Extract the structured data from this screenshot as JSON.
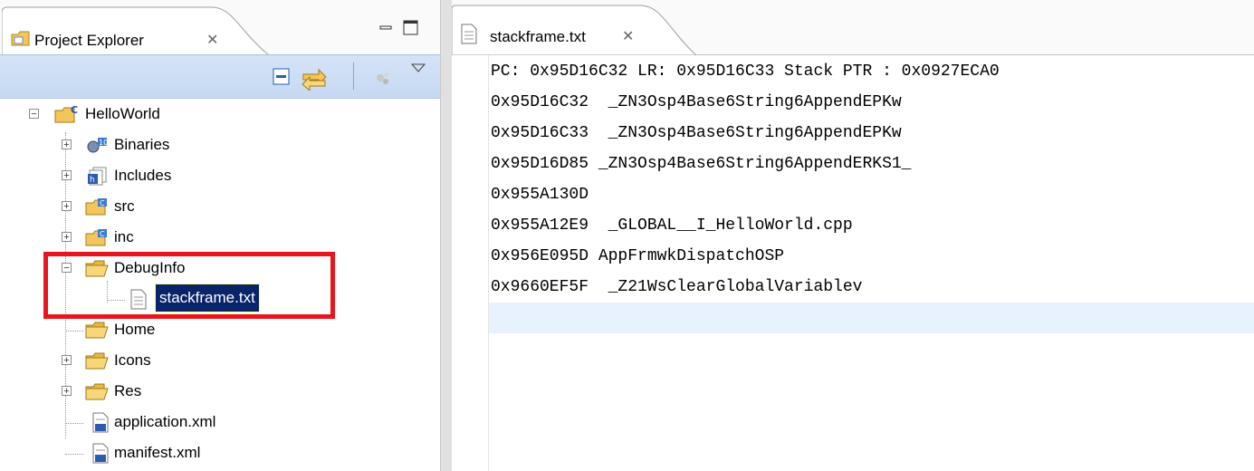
{
  "explorer": {
    "title": "Project Explorer",
    "close_glyph": "✕",
    "toolbar": {
      "collapse_icon": "collapse-all-icon",
      "link_icon": "link-with-editor-icon",
      "filter_icon": "filter-icon",
      "menu_icon": "view-menu-icon"
    },
    "tree": [
      {
        "label": "HelloWorld",
        "expander": "−"
      },
      {
        "label": "Binaries",
        "expander": "+"
      },
      {
        "label": "Includes",
        "expander": "+"
      },
      {
        "label": "src",
        "expander": "+"
      },
      {
        "label": "inc",
        "expander": "+"
      },
      {
        "label": "DebugInfo",
        "expander": "−"
      },
      {
        "label": "stackframe.txt",
        "expander": ""
      },
      {
        "label": "Home",
        "expander": ""
      },
      {
        "label": "Icons",
        "expander": "+"
      },
      {
        "label": "Res",
        "expander": "+"
      },
      {
        "label": "application.xml",
        "expander": ""
      },
      {
        "label": "manifest.xml",
        "expander": ""
      }
    ]
  },
  "editor": {
    "tab_title": "stackframe.txt",
    "close_glyph": "✕",
    "lines": [
      "PC: 0x95D16C32 LR: 0x95D16C33 Stack PTR : 0x0927ECA0",
      "0x95D16C32  _ZN3Osp4Base6String6AppendEPKw",
      "0x95D16C33  _ZN3Osp4Base6String6AppendEPKw",
      "0x95D16D85 _ZN3Osp4Base6String6AppendERKS1_",
      "0x955A130D",
      "0x955A12E9  _GLOBAL__I_HelloWorld.cpp",
      "0x956E095D AppFrmwkDispatchOSP",
      "0x9660EF5F  _Z21WsClearGlobalVariablev"
    ]
  },
  "colors": {
    "highlight_box": "#e8151d",
    "selection": "#0a246a",
    "current_line": "#e8f2fe",
    "toolbar": "#c6d9f2"
  }
}
